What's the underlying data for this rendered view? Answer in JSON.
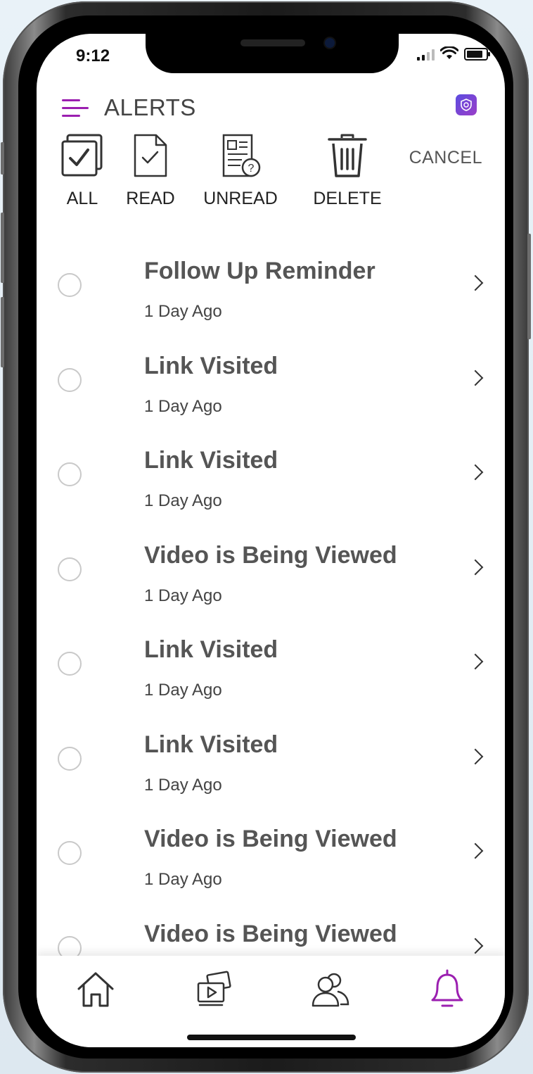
{
  "status_bar": {
    "time": "9:12"
  },
  "header": {
    "title": "ALERTS"
  },
  "toolbar": {
    "all_label": "ALL",
    "read_label": "READ",
    "unread_label": "UNREAD",
    "delete_label": "DELETE",
    "cancel_label": "CANCEL"
  },
  "alerts": [
    {
      "title": "Follow Up Reminder",
      "time": "1 Day Ago"
    },
    {
      "title": "Link Visited",
      "time": "1 Day Ago"
    },
    {
      "title": "Link Visited",
      "time": "1 Day Ago"
    },
    {
      "title": "Video is Being Viewed",
      "time": "1 Day Ago"
    },
    {
      "title": "Link Visited",
      "time": "1 Day Ago"
    },
    {
      "title": "Link Visited",
      "time": "1 Day Ago"
    },
    {
      "title": "Video is Being Viewed",
      "time": "1 Day Ago"
    },
    {
      "title": "Video is Being Viewed",
      "time": ""
    }
  ],
  "tab_bar": {
    "items": [
      {
        "icon": "home-icon",
        "active": false
      },
      {
        "icon": "media-library-icon",
        "active": false
      },
      {
        "icon": "contacts-icon",
        "active": false
      },
      {
        "icon": "bell-icon",
        "active": true
      }
    ]
  },
  "colors": {
    "accent": "#9b1fb0",
    "text": "#444444",
    "divider": "#c9c9c9"
  }
}
